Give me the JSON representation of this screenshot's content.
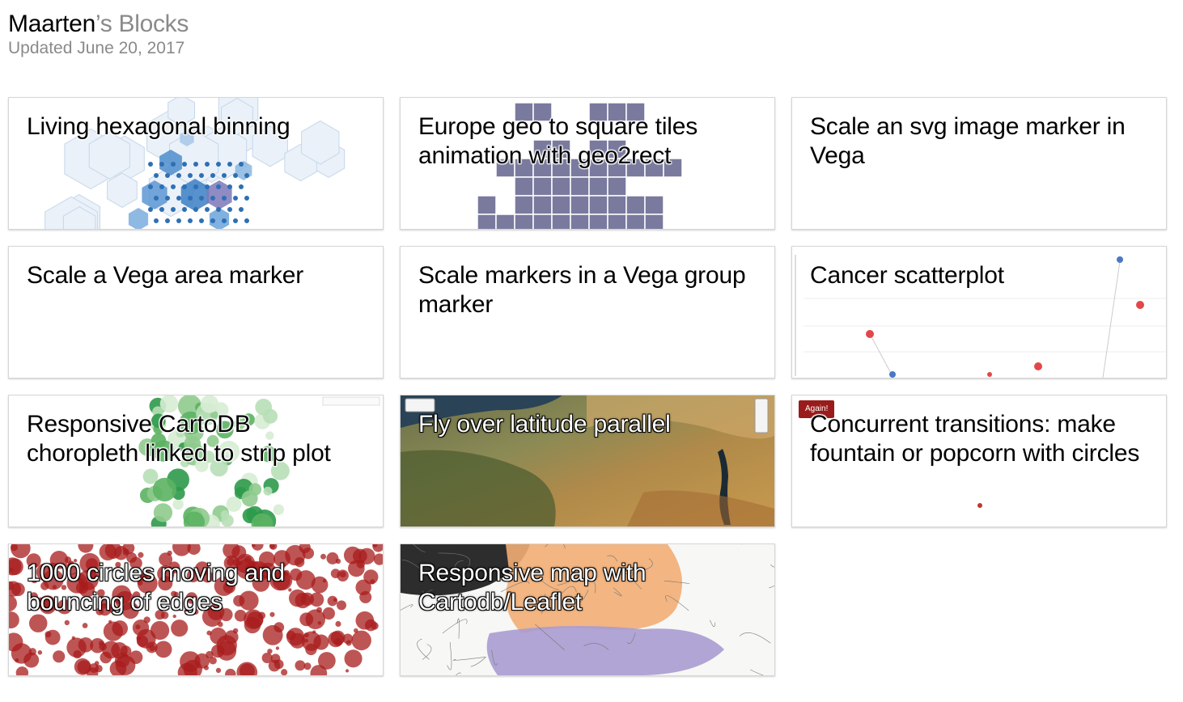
{
  "header": {
    "title_main": "Maarten",
    "title_dim": "’s Blocks",
    "updated": "Updated June 20, 2017"
  },
  "cards": [
    {
      "title": "Living hexagonal binning",
      "thumb": "hexbin"
    },
    {
      "title": "Europe geo to square tiles animation with geo2rect",
      "thumb": "square-tiles"
    },
    {
      "title": "Scale an svg image marker in Vega",
      "thumb": "blank"
    },
    {
      "title": "Scale a Vega area marker",
      "thumb": "blank"
    },
    {
      "title": "Scale markers in a Vega group marker",
      "thumb": "blank"
    },
    {
      "title": "Cancer scatterplot",
      "thumb": "scatter"
    },
    {
      "title": "Responsive CartoDB choropleth linked to strip plot",
      "thumb": "green-map"
    },
    {
      "title": "Fly over latitude parallel",
      "thumb": "satellite"
    },
    {
      "title": "Concurrent transitions: make fountain or popcorn with circles",
      "thumb": "popcorn",
      "badge": "Again!"
    },
    {
      "title": "1000 circles moving and bouncing of edges",
      "thumb": "red-circles"
    },
    {
      "title": "Responsive map with Cartodb/Leaflet",
      "thumb": "leaflet-map"
    }
  ],
  "colors": {
    "hex_blue": "#3b7fc4",
    "tile_purple": "#7a7a9e",
    "circle_red": "#a81c1c",
    "map_green": "#3aa655",
    "scatter_red": "#e2474a",
    "scatter_blue": "#4a78c4",
    "badge_red": "#9a1b1b"
  }
}
